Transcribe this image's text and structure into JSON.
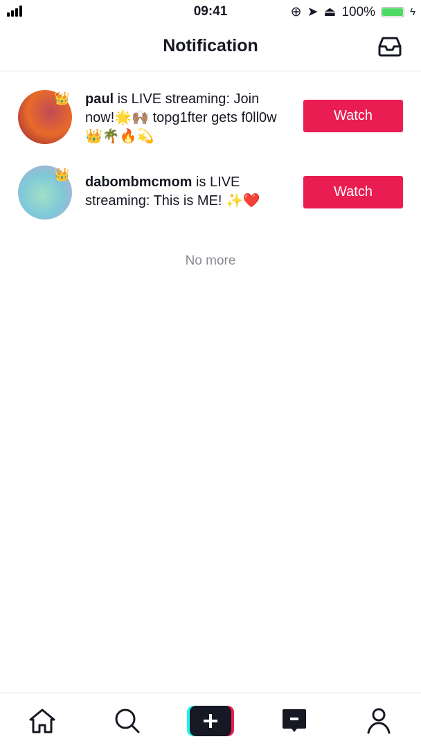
{
  "status_bar": {
    "time": "09:41",
    "battery": "100%",
    "battery_level": 1.0,
    "icons": [
      "signal-icon",
      "orientation-lock-icon",
      "location-icon",
      "airplay-icon",
      "battery-icon",
      "charging-icon"
    ]
  },
  "header": {
    "title": "Notification",
    "inbox_icon": "inbox-icon"
  },
  "notifications": [
    {
      "username": "paul",
      "message": " is LIVE streaming: Join now!🌟🙌🏽  topg1fter gets f0ll0w 👑🌴🔥💫",
      "button": "Watch"
    },
    {
      "username": "dabombmcmom",
      "message": " is LIVE streaming: This is ME! ✨❤️",
      "button": "Watch"
    }
  ],
  "footer_text": "No more",
  "tabbar": {
    "items": [
      "home-icon",
      "search-icon",
      "create-icon",
      "inbox-message-icon",
      "profile-icon"
    ]
  },
  "colors": {
    "accent": "#ea1d52",
    "cyan": "#25f4ee",
    "dark": "#161823"
  }
}
